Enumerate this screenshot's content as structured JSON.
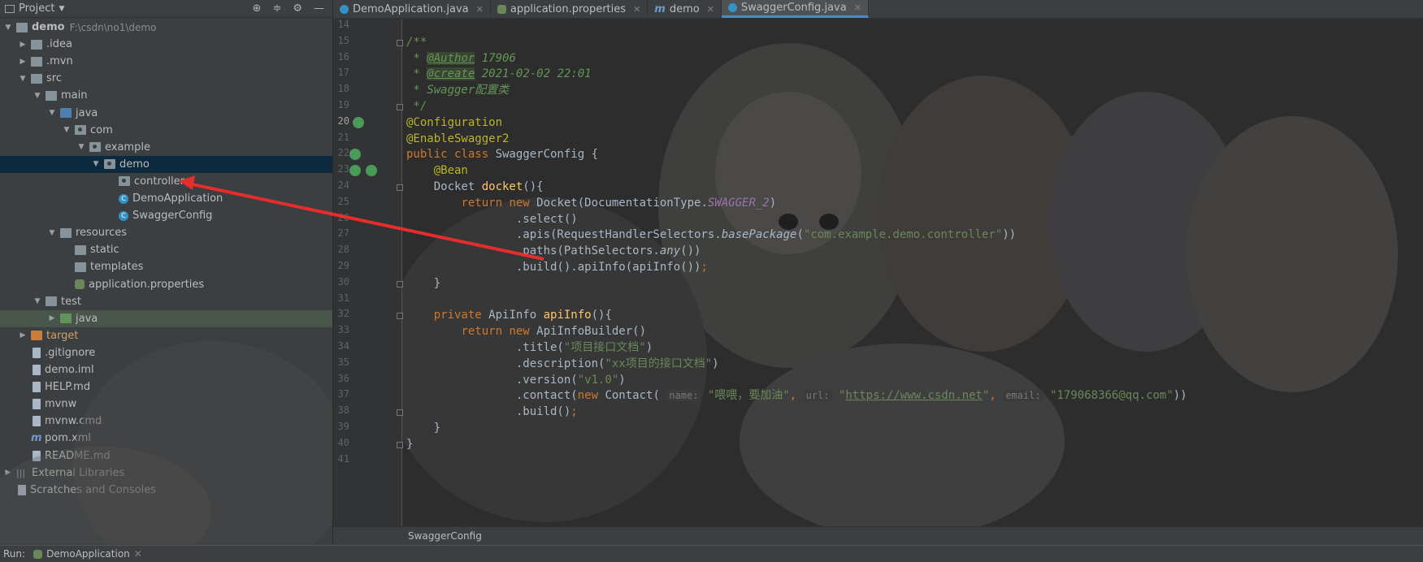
{
  "project_panel": {
    "title": "Project",
    "tree": [
      {
        "label": "demo",
        "path": "F:\\csdn\\no1\\demo",
        "depth": 0,
        "arrow": "down",
        "icon": "module-folder",
        "bold": true
      },
      {
        "label": ".idea",
        "depth": 1,
        "arrow": "right",
        "icon": "folder"
      },
      {
        "label": ".mvn",
        "depth": 1,
        "arrow": "right",
        "icon": "folder"
      },
      {
        "label": "src",
        "depth": 1,
        "arrow": "down",
        "icon": "folder"
      },
      {
        "label": "main",
        "depth": 2,
        "arrow": "down",
        "icon": "folder"
      },
      {
        "label": "java",
        "depth": 3,
        "arrow": "down",
        "icon": "source-folder"
      },
      {
        "label": "com",
        "depth": 4,
        "arrow": "down",
        "icon": "package"
      },
      {
        "label": "example",
        "depth": 5,
        "arrow": "down",
        "icon": "package"
      },
      {
        "label": "demo",
        "depth": 6,
        "arrow": "down",
        "icon": "package",
        "selected": true
      },
      {
        "label": "controller",
        "depth": 7,
        "arrow": "",
        "icon": "package"
      },
      {
        "label": "DemoApplication",
        "depth": 7,
        "arrow": "",
        "icon": "spring-class"
      },
      {
        "label": "SwaggerConfig",
        "depth": 7,
        "arrow": "",
        "icon": "class"
      },
      {
        "label": "resources",
        "depth": 3,
        "arrow": "down",
        "icon": "resources-folder"
      },
      {
        "label": "static",
        "depth": 4,
        "arrow": "",
        "icon": "folder"
      },
      {
        "label": "templates",
        "depth": 4,
        "arrow": "",
        "icon": "folder"
      },
      {
        "label": "application.properties",
        "depth": 4,
        "arrow": "",
        "icon": "properties-file"
      },
      {
        "label": "test",
        "depth": 2,
        "arrow": "down",
        "icon": "folder"
      },
      {
        "label": "java",
        "depth": 3,
        "arrow": "right",
        "icon": "test-folder",
        "highlight": true
      },
      {
        "label": "target",
        "depth": 1,
        "arrow": "right",
        "icon": "target-folder",
        "orange": true
      },
      {
        "label": ".gitignore",
        "depth": 1,
        "arrow": "",
        "icon": "file"
      },
      {
        "label": "demo.iml",
        "depth": 1,
        "arrow": "",
        "icon": "file"
      },
      {
        "label": "HELP.md",
        "depth": 1,
        "arrow": "",
        "icon": "markdown-file"
      },
      {
        "label": "mvnw",
        "depth": 1,
        "arrow": "",
        "icon": "file"
      },
      {
        "label": "mvnw.cmd",
        "depth": 1,
        "arrow": "",
        "icon": "file"
      },
      {
        "label": "pom.xml",
        "depth": 1,
        "arrow": "",
        "icon": "maven-file"
      },
      {
        "label": "README.md",
        "depth": 1,
        "arrow": "",
        "icon": "markdown-file"
      },
      {
        "label": "External Libraries",
        "depth": 0,
        "arrow": "right",
        "icon": "libraries"
      },
      {
        "label": "Scratches and Consoles",
        "depth": 0,
        "arrow": "",
        "icon": "scratches"
      }
    ]
  },
  "tabs": [
    {
      "label": "DemoApplication.java",
      "icon": "spring-class",
      "active": false
    },
    {
      "label": "application.properties",
      "icon": "properties-file",
      "active": false
    },
    {
      "label": "demo",
      "icon": "maven-file",
      "active": false
    },
    {
      "label": "SwaggerConfig.java",
      "icon": "class",
      "active": true
    }
  ],
  "editor": {
    "line_numbers": [
      "14",
      "15",
      "16",
      "17",
      "18",
      "19",
      "20",
      "21",
      "22",
      "23",
      "24",
      "25",
      "26",
      "27",
      "28",
      "29",
      "30",
      "31",
      "32",
      "33",
      "34",
      "35",
      "36",
      "37",
      "38",
      "39",
      "40",
      "41"
    ],
    "current_line": "20",
    "breadcrumb": "SwaggerConfig"
  },
  "run_bar": {
    "label": "Run:",
    "config": "DemoApplication"
  }
}
